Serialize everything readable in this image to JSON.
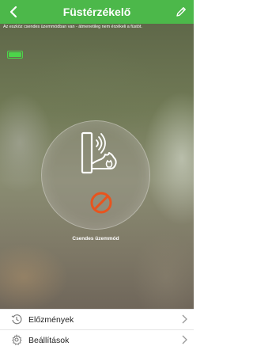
{
  "header": {
    "title": "Füstérzékelő",
    "back_icon": "chevron-left-icon",
    "edit_icon": "pencil-icon",
    "color": "#4cb84a"
  },
  "status": {
    "notice": "Az eszköz csendes üzemmódban van - átmenetileg nem érzékeli a füstöt.",
    "battery_icon": "battery-icon",
    "battery_level": 1.0,
    "battery_color": "#4cd44a"
  },
  "device": {
    "icon": "smoke-detector-icon",
    "state_icon": "no-symbol-icon",
    "state_color": "#e8541e",
    "mode_label": "Csendes üzemmód"
  },
  "menu": {
    "items": [
      {
        "label": "Előzmények",
        "icon": "history-icon"
      },
      {
        "label": "Beállítások",
        "icon": "gear-icon"
      }
    ]
  }
}
